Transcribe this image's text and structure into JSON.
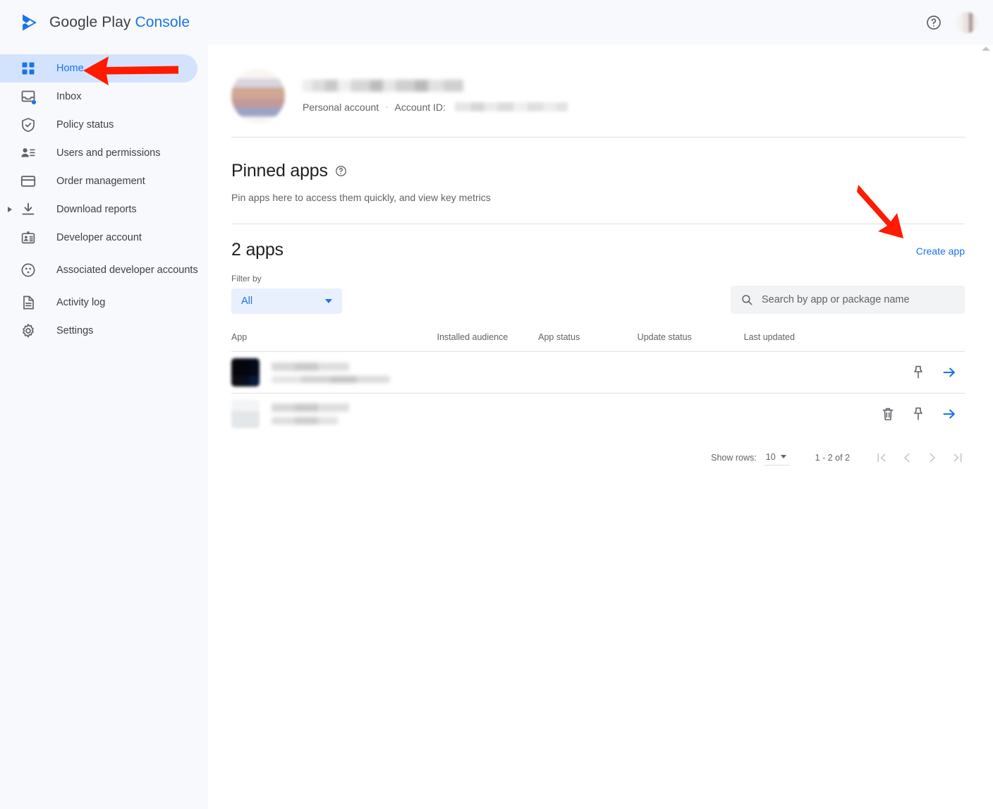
{
  "topbar": {
    "brand_google_play": "Google Play",
    "brand_console": "Console",
    "logo_icon": "play-triangle-logo",
    "help_icon": "help-circle-icon",
    "avatar_icon": "user-avatar"
  },
  "sidebar": {
    "items": [
      {
        "label": "Home",
        "icon": "grid-icon",
        "active": true
      },
      {
        "label": "Inbox",
        "icon": "inbox-icon",
        "active": false,
        "badge_dot": true
      },
      {
        "label": "Policy status",
        "icon": "shield-check-icon",
        "active": false
      },
      {
        "label": "Users and permissions",
        "icon": "person-list-icon",
        "active": false
      },
      {
        "label": "Order management",
        "icon": "credit-card-icon",
        "active": false
      },
      {
        "label": "Download reports",
        "icon": "download-icon",
        "active": false,
        "expandable": true
      },
      {
        "label": "Developer account",
        "icon": "id-badge-icon",
        "active": false
      },
      {
        "label": "Associated developer accounts",
        "icon": "circle-dots-icon",
        "active": false
      },
      {
        "label": "Activity log",
        "icon": "document-icon",
        "active": false
      },
      {
        "label": "Settings",
        "icon": "gear-icon",
        "active": false
      }
    ]
  },
  "account": {
    "name_redacted": "",
    "type": "Personal account",
    "separator": "·",
    "account_id_label": "Account ID:",
    "account_id_redacted": ""
  },
  "pinned": {
    "title": "Pinned apps",
    "help_icon": "help-circle-icon",
    "subtitle": "Pin apps here to access them quickly, and view key metrics"
  },
  "apps_section": {
    "count_label": "2 apps",
    "create_app_label": "Create app",
    "filter_label": "Filter by",
    "filter_value": "All",
    "search_placeholder": "Search by app or package name",
    "search_value": "",
    "search_icon": "search-icon",
    "columns": [
      "App",
      "Installed audience",
      "App status",
      "Update status",
      "Last updated"
    ],
    "rows": [
      {
        "app_name_redacted": "",
        "app_subtitle_redacted": "",
        "installed_audience_redacted": "",
        "app_status_redacted": "",
        "update_status_redacted": "",
        "last_updated_redacted": "",
        "has_delete": false,
        "pin_icon": "pin-icon",
        "open_icon": "arrow-right-icon"
      },
      {
        "app_name_redacted": "",
        "app_subtitle_redacted": "",
        "installed_audience_redacted": "",
        "app_status_redacted": "",
        "update_status_redacted": "",
        "last_updated_redacted": "",
        "has_delete": true,
        "delete_icon": "trash-icon",
        "pin_icon": "pin-icon",
        "open_icon": "arrow-right-icon"
      }
    ]
  },
  "pagination": {
    "show_rows_label": "Show rows:",
    "rows_per_page": "10",
    "range_text": "1 - 2 of 2",
    "first_icon": "first-page-icon",
    "prev_icon": "previous-page-icon",
    "next_icon": "next-page-icon",
    "last_icon": "last-page-icon"
  },
  "annotations": [
    {
      "name": "arrow-pointing-to-home",
      "color": "#ff1a00",
      "direction": "left"
    },
    {
      "name": "arrow-pointing-to-create-app",
      "color": "#ff1a00",
      "direction": "down-right"
    }
  ],
  "colors": {
    "brand_blue": "#1a73e8",
    "sidebar_bg": "#f8f9fd",
    "active_pill": "#d3e3fd",
    "chip_bg": "#e8f0fe",
    "search_bg": "#f1f3f4",
    "annotation_red": "#ff1a00"
  }
}
